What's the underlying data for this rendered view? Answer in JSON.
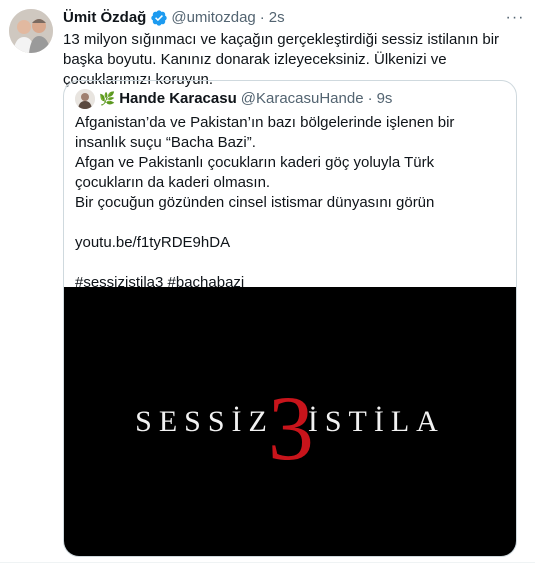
{
  "tweet": {
    "name": "Ümit Özdağ",
    "handle": "@umitozdag",
    "dot": "·",
    "time": "2s",
    "text": "13 milyon sığınmacı ve kaçağın gerçekleştirdiği sessiz istilanın bir başka boyutu. Kanınız donarak izleyeceksiniz. Ülkenizi ve çocuklarımızı koruyun.",
    "more": "···"
  },
  "quote": {
    "icon": "🌿",
    "name": "Hande Karacasu",
    "handle": "@KaracasuHande",
    "dot": "·",
    "time": "9s",
    "lines": {
      "l1": "Afganistan’da ve Pakistan’ın bazı bölgelerinde işlenen bir insanlık suçu “Bacha Bazi”.",
      "l2": "Afgan ve Pakistanlı çocukların kaderi göç yoluyla Türk çocukların da kaderi olmasın.",
      "l3": "Bir çocuğun gözünden cinsel istismar dünyasını görün",
      "link": "youtu.be/f1tyRDE9hDA",
      "hashtags": "#sessizistila3 #bachabazi"
    },
    "media": {
      "word_left": "SESSİZ",
      "number": "3",
      "word_right": "İSTİLA"
    }
  },
  "colors": {
    "verified": "#1d9bf0",
    "secondary_text": "#536471",
    "border": "#cfd9de",
    "accent_red": "#c8141b"
  }
}
